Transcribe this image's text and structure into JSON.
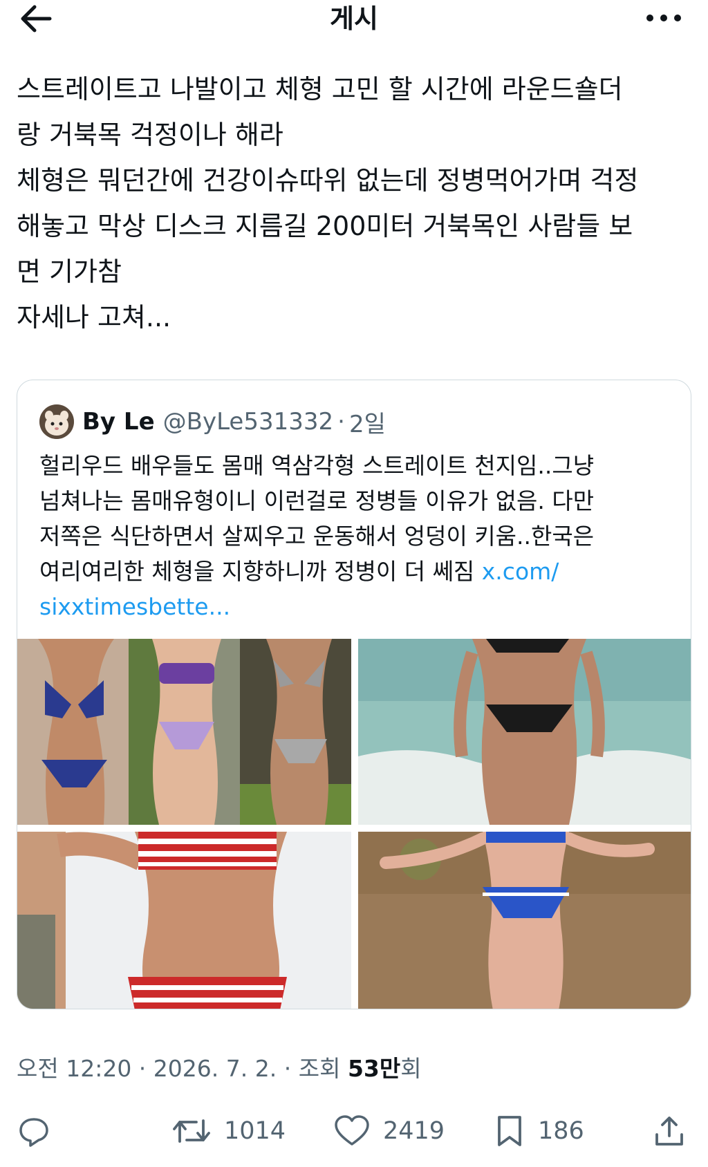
{
  "header": {
    "title": "게시",
    "back_icon": "arrow-left-icon",
    "more_icon": "more-horizontal-icon"
  },
  "post": {
    "lines": [
      "스트레이트고 나발이고 체형 고민 할 시간에 라운드숄더",
      "랑 거북목 걱정이나 해라",
      "체형은 뭐던간에 건강이슈따위 없는데 정병먹어가며 걱정",
      "해놓고 막상 디스크 지름길 200미터 거북목인 사람들 보",
      "면 기가참",
      "자세나 고쳐..."
    ]
  },
  "quote": {
    "name": "By Le",
    "handle": "@ByLe531332",
    "separator": "·",
    "time": "2일",
    "lines": [
      "헐리우드 배우들도 몸매 역삼각형 스트레이트 천지임..그냥",
      "넘쳐나는 몸매유형이니 이런걸로 정병들 이유가 없음. 다만",
      "저쪽은 식단하면서 살찌우고 운동해서 엉덩이 키움..한국은",
      "여리여리한 체형을 지향하니까 정병이 더 쎄짐 "
    ],
    "link_part1": "x.com/",
    "link_part2": "sixxtimesbette...",
    "images": [
      {
        "name": "photo-collage-top-left"
      },
      {
        "name": "photo-beach-top-right"
      },
      {
        "name": "photo-striped-bikini-bottom-left"
      },
      {
        "name": "photo-blue-bikini-bottom-right"
      }
    ]
  },
  "meta": {
    "time": "오전 12:20",
    "sep1": " · ",
    "date": "2026. 7. 2.",
    "sep2": " · ",
    "views_label": "조회 ",
    "views_value": "53만",
    "views_suffix": "회"
  },
  "actions": {
    "reply_icon": "reply-icon",
    "retweet_icon": "retweet-icon",
    "retweet_count": "1014",
    "like_icon": "heart-icon",
    "like_count": "2419",
    "bookmark_icon": "bookmark-icon",
    "bookmark_count": "186",
    "share_icon": "share-icon"
  },
  "colors": {
    "text": "#0f1419",
    "secondary": "#536471",
    "link": "#1d9bf0",
    "border": "#cfd9de"
  }
}
